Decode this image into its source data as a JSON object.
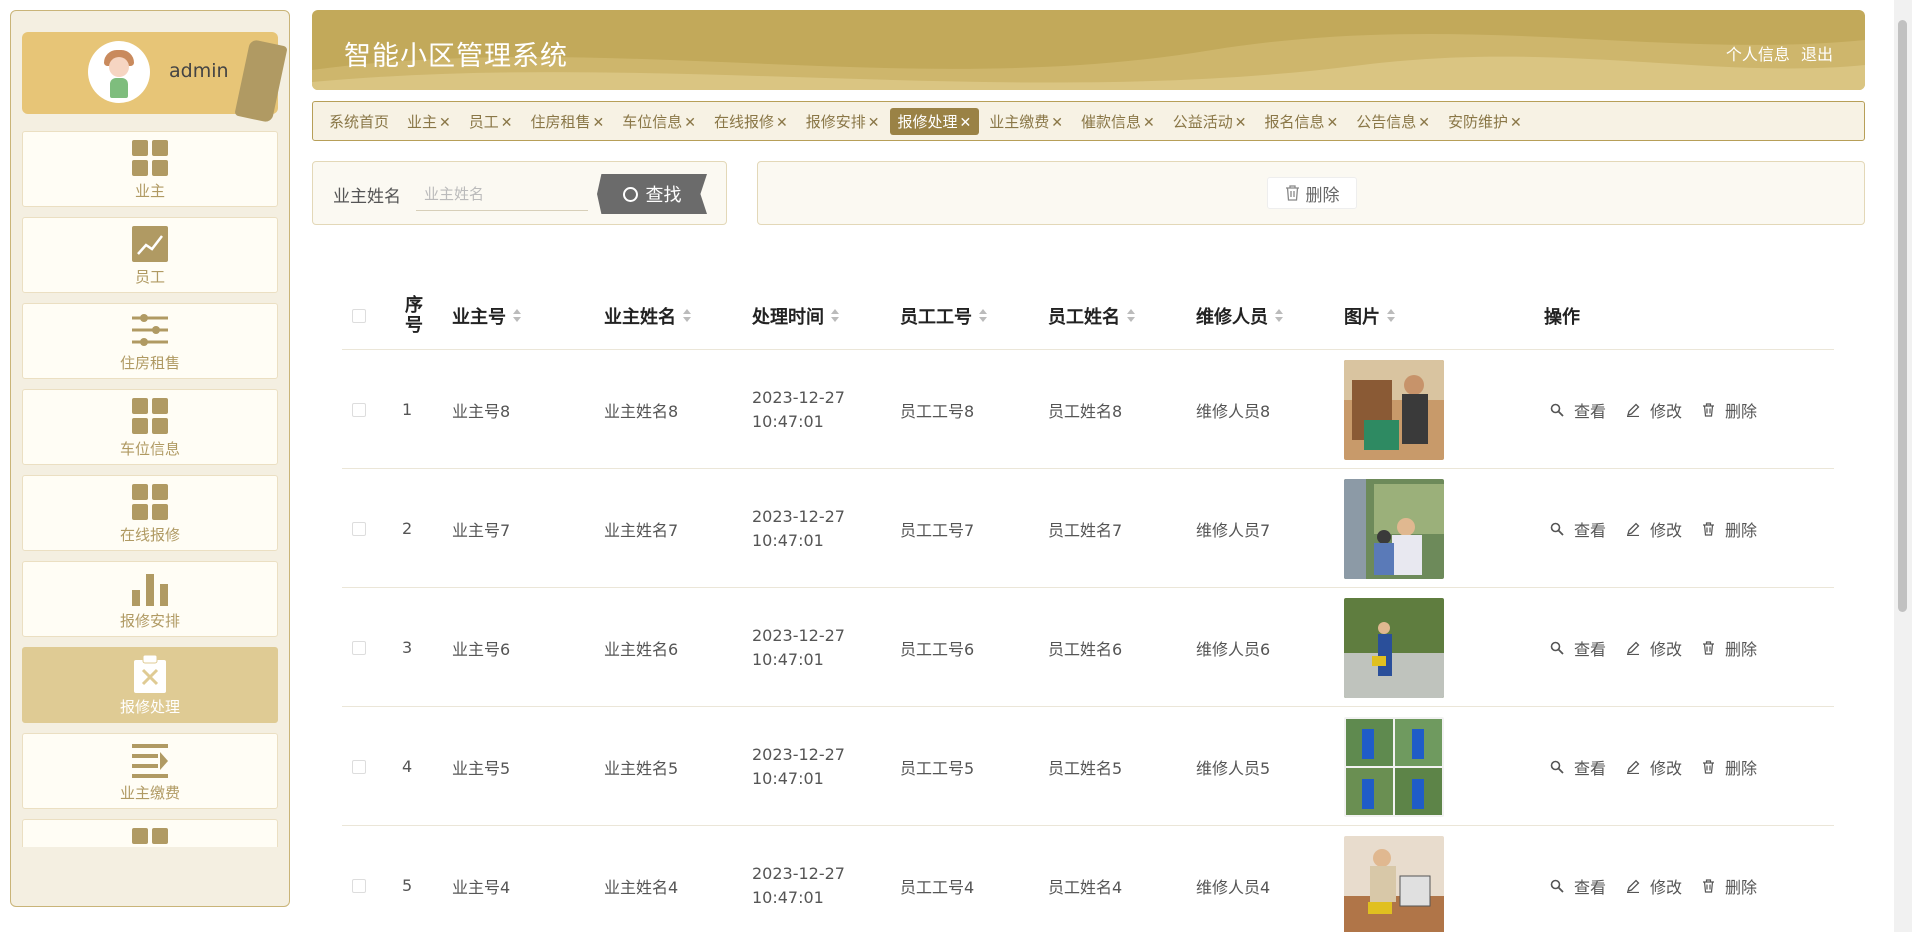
{
  "app": {
    "title": "智能小区管理系统",
    "user_info": "个人信息",
    "logout": "退出"
  },
  "user": {
    "name": "admin"
  },
  "sidebar": {
    "items": [
      {
        "label": "业主",
        "icon": "grid-icon"
      },
      {
        "label": "员工",
        "icon": "trend-chart-icon"
      },
      {
        "label": "住房租售",
        "icon": "sliders-icon"
      },
      {
        "label": "车位信息",
        "icon": "grid-icon"
      },
      {
        "label": "在线报修",
        "icon": "grid-icon"
      },
      {
        "label": "报修安排",
        "icon": "bar-chart-icon"
      },
      {
        "label": "报修处理",
        "icon": "clipboard-x-icon",
        "active": true
      },
      {
        "label": "业主缴费",
        "icon": "list-arrow-icon"
      },
      {
        "label": "",
        "icon": "grid-icon"
      }
    ]
  },
  "tabs": [
    {
      "label": "系统首页",
      "closable": false
    },
    {
      "label": "业主",
      "closable": true
    },
    {
      "label": "员工",
      "closable": true
    },
    {
      "label": "住房租售",
      "closable": true
    },
    {
      "label": "车位信息",
      "closable": true
    },
    {
      "label": "在线报修",
      "closable": true
    },
    {
      "label": "报修安排",
      "closable": true
    },
    {
      "label": "报修处理",
      "closable": true,
      "active": true
    },
    {
      "label": "业主缴费",
      "closable": true
    },
    {
      "label": "催款信息",
      "closable": true
    },
    {
      "label": "公益活动",
      "closable": true
    },
    {
      "label": "报名信息",
      "closable": true
    },
    {
      "label": "公告信息",
      "closable": true
    },
    {
      "label": "安防维护",
      "closable": true
    }
  ],
  "search": {
    "label": "业主姓名",
    "placeholder": "业主姓名",
    "button": "查找"
  },
  "toolbar": {
    "delete": "删除"
  },
  "table": {
    "headers": {
      "index": "序号",
      "owner_no": "业主号",
      "owner_name": "业主姓名",
      "time": "处理时间",
      "staff_no": "员工工号",
      "staff_name": "员工姓名",
      "repairer": "维修人员",
      "image": "图片",
      "actions": "操作"
    },
    "actions": {
      "view": "查看",
      "edit": "修改",
      "delete": "删除"
    },
    "rows": [
      {
        "index": "1",
        "owner_no": "业主号8",
        "owner_name": "业主姓名8",
        "time": "2023-12-27 10:47:01",
        "staff_no": "员工工号8",
        "staff_name": "员工姓名8",
        "repairer": "维修人员8"
      },
      {
        "index": "2",
        "owner_no": "业主号7",
        "owner_name": "业主姓名7",
        "time": "2023-12-27 10:47:01",
        "staff_no": "员工工号7",
        "staff_name": "员工姓名7",
        "repairer": "维修人员7"
      },
      {
        "index": "3",
        "owner_no": "业主号6",
        "owner_name": "业主姓名6",
        "time": "2023-12-27 10:47:01",
        "staff_no": "员工工号6",
        "staff_name": "员工姓名6",
        "repairer": "维修人员6"
      },
      {
        "index": "4",
        "owner_no": "业主号5",
        "owner_name": "业主姓名5",
        "time": "2023-12-27 10:47:01",
        "staff_no": "员工工号5",
        "staff_name": "员工姓名5",
        "repairer": "维修人员5"
      },
      {
        "index": "5",
        "owner_no": "业主号4",
        "owner_name": "业主姓名4",
        "time": "2023-12-27 10:47:01",
        "staff_no": "员工工号4",
        "staff_name": "员工姓名4",
        "repairer": "维修人员4"
      }
    ]
  },
  "colors": {
    "accent": "#c2a95a",
    "active": "#9a8245",
    "sidebar_icon": "#b09a63"
  }
}
